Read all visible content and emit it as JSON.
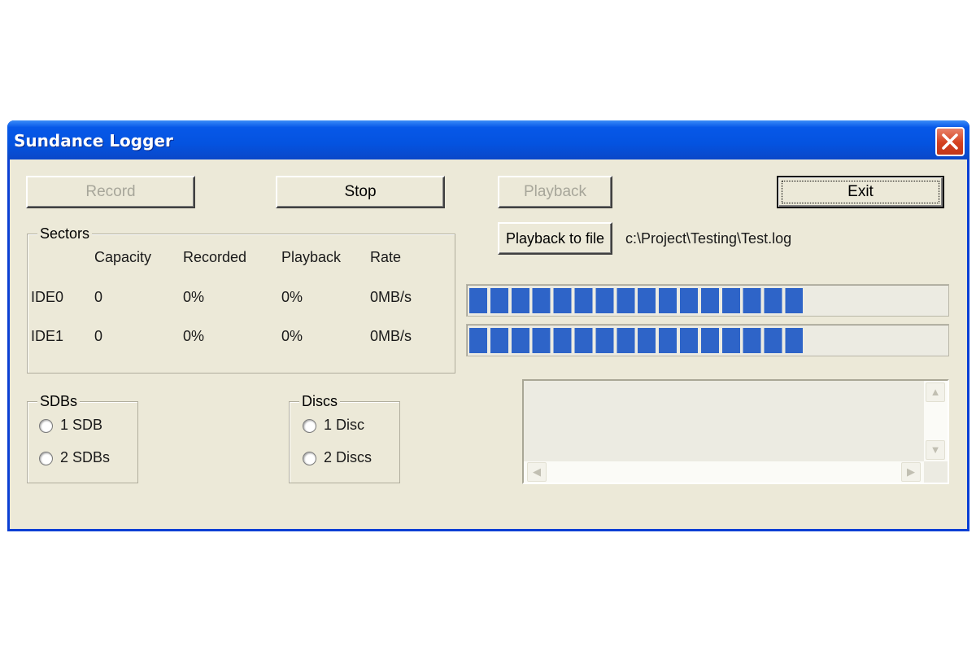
{
  "window": {
    "title": "Sundance Logger"
  },
  "buttons": {
    "record": "Record",
    "stop": "Stop",
    "playback": "Playback",
    "exit": "Exit",
    "playback_to_file": "Playback to file"
  },
  "file_path": "c:\\Project\\Testing\\Test.log",
  "sectors": {
    "label": "Sectors",
    "headers": [
      "Capacity",
      "Recorded",
      "Playback",
      "Rate"
    ],
    "rows": [
      {
        "name": "IDE0",
        "capacity": "0",
        "recorded": "0%",
        "playback": "0%",
        "rate": "0MB/s"
      },
      {
        "name": "IDE1",
        "capacity": "0",
        "recorded": "0%",
        "playback": "0%",
        "rate": "0MB/s"
      }
    ]
  },
  "sdbs": {
    "label": "SDBs",
    "options": [
      "1 SDB",
      "2 SDBs"
    ]
  },
  "discs": {
    "label": "Discs",
    "options": [
      "1 Disc",
      "2 Discs"
    ]
  },
  "progress": [
    0.7,
    0.7
  ],
  "colors": {
    "titlebar": "#0453e0",
    "progress_block": "#2e64c8",
    "dialog_bg": "#ece9d8",
    "close_button": "#d4411f"
  },
  "icons": {
    "close": "close-icon",
    "scroll_up": "chevron-up-icon",
    "scroll_down": "chevron-down-icon",
    "scroll_left": "chevron-left-icon",
    "scroll_right": "chevron-right-icon"
  }
}
